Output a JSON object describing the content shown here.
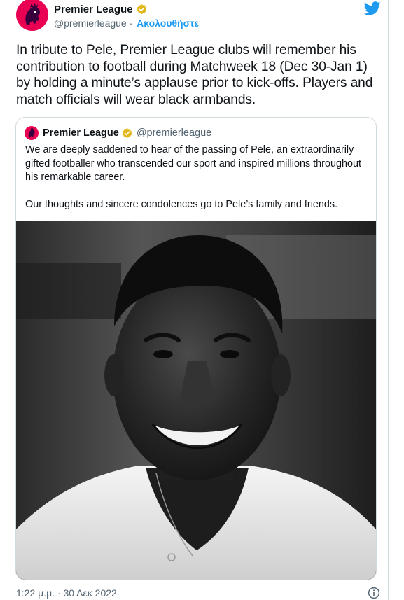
{
  "author": {
    "display_name": "Premier League",
    "handle": "@premierleague",
    "separator": "·",
    "follow_label": "Ακολουθήστε"
  },
  "tweet": {
    "text": "In tribute to Pele, Premier League clubs will remember his contribution to football during Matchweek 18 (Dec 30-Jan 1) by holding a minute’s applause prior to kick-offs. Players and match officials will wear black armbands."
  },
  "quoted_tweet": {
    "display_name": "Premier League",
    "handle": "@premierleague",
    "text": "We are deeply saddened to hear of the passing of Pele, an extraordinarily gifted footballer who transcended our sport and inspired millions throughout his remarkable career.\n\nOur thoughts and sincere condolences go to Pele’s family and friends.",
    "image_subject": "black-and-white portrait of Pele smiling"
  },
  "footer": {
    "timestamp": "1:22 μ.μ. · 30 Δεκ 2022"
  },
  "colors": {
    "brand": "#e90052",
    "link": "#1d9bf0",
    "verified": "#e2b719",
    "secondary_text": "#536471"
  },
  "icons": [
    "premier-league-lion-icon",
    "verified-badge-icon",
    "twitter-bird-icon",
    "info-icon"
  ]
}
